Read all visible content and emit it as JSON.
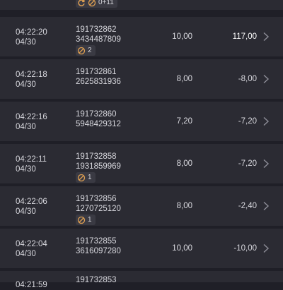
{
  "top_partial": {
    "icons": [
      "refresh-icon",
      "cancel-icon"
    ],
    "badge_text": "0+11"
  },
  "rows": [
    {
      "time": "04:22:20",
      "date": "04/30",
      "id1": "191732862",
      "id2": "3434487809",
      "badge": "2",
      "stake": "10,00",
      "pl": "117,00",
      "positive": true
    },
    {
      "time": "04:22:18",
      "date": "04/30",
      "id1": "191732861",
      "id2": "2625831936",
      "badge": null,
      "stake": "8,00",
      "pl": "-8,00",
      "positive": false
    },
    {
      "time": "04:22:16",
      "date": "04/30",
      "id1": "191732860",
      "id2": "5948429312",
      "badge": null,
      "stake": "7,20",
      "pl": "-7,20",
      "positive": false
    },
    {
      "time": "04:22:11",
      "date": "04/30",
      "id1": "191732858",
      "id2": "1931859969",
      "badge": "1",
      "stake": "8,00",
      "pl": "-7,20",
      "positive": false
    },
    {
      "time": "04:22:06",
      "date": "04/30",
      "id1": "191732856",
      "id2": "1270725120",
      "badge": "1",
      "stake": "8,00",
      "pl": "-2,40",
      "positive": false
    },
    {
      "time": "04:22:04",
      "date": "04/30",
      "id1": "191732855",
      "id2": "3616097280",
      "badge": null,
      "stake": "10,00",
      "pl": "-10,00",
      "positive": false
    }
  ],
  "bottom_partial": {
    "time": "04:21:59",
    "id1": "191732853"
  }
}
